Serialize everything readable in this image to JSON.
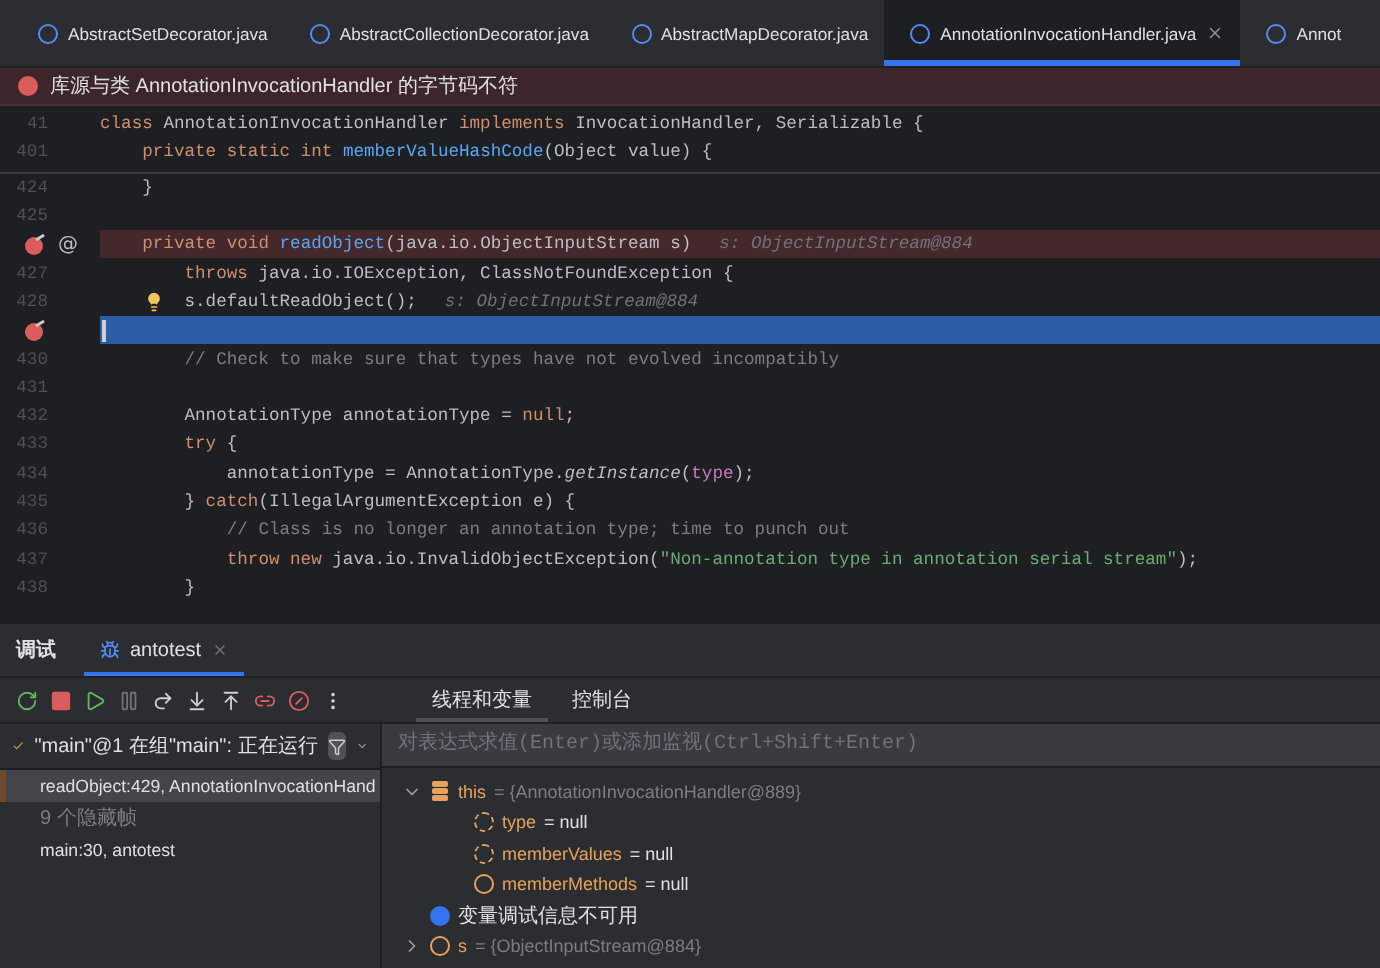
{
  "editor_tabs": [
    {
      "label": "AbstractSetDecorator.java",
      "selected": false,
      "closable": false
    },
    {
      "label": "AbstractCollectionDecorator.java",
      "selected": false,
      "closable": false
    },
    {
      "label": "AbstractMapDecorator.java",
      "selected": false,
      "closable": false
    },
    {
      "label": "AnnotationInvocationHandler.java",
      "selected": true,
      "closable": true
    },
    {
      "label": "Annot",
      "selected": false,
      "closable": false
    }
  ],
  "banner": {
    "message": "库源与类 AnnotationInvocationHandler 的字节码不符"
  },
  "sticky_lines": [
    {
      "number": "41",
      "tokens": [
        {
          "text": "class ",
          "kind": "kw"
        },
        {
          "text": "AnnotationInvocationHandler ",
          "kind": "plain"
        },
        {
          "text": "implements ",
          "kind": "kw"
        },
        {
          "text": "InvocationHandler, Serializable {",
          "kind": "plain"
        }
      ]
    },
    {
      "number": "401",
      "tokens": [
        {
          "text": "    private static int ",
          "kind": "kw"
        },
        {
          "text": "memberValueHashCode",
          "kind": "fn"
        },
        {
          "text": "(Object value) {",
          "kind": "plain"
        }
      ]
    }
  ],
  "code_lines": [
    {
      "number": "424",
      "breakpoint": false,
      "current": false,
      "bulb": false,
      "tokens": [
        {
          "text": "    }",
          "kind": "plain"
        }
      ]
    },
    {
      "number": "425",
      "breakpoint": false,
      "current": false,
      "bulb": false
    },
    {
      "breakpoint": true,
      "override_mark": "@",
      "current": false,
      "bulb": false,
      "tokens": [
        {
          "text": "    private void ",
          "kind": "kw"
        },
        {
          "text": "readObject",
          "kind": "fn"
        },
        {
          "text": "(java.io.ObjectInputStream s)",
          "kind": "plain"
        }
      ],
      "hint": "s: ObjectInputStream@884"
    },
    {
      "number": "427",
      "breakpoint": false,
      "current": false,
      "bulb": false,
      "tokens": [
        {
          "text": "        throws ",
          "kind": "kw"
        },
        {
          "text": "java.io.IOException, ClassNotFoundException {",
          "kind": "plain"
        }
      ]
    },
    {
      "number": "428",
      "breakpoint": false,
      "current": false,
      "bulb": true,
      "tokens": [
        {
          "text": "        s.defaultReadObject();",
          "kind": "plain"
        }
      ],
      "hint": "s: ObjectInputStream@884"
    },
    {
      "breakpoint": true,
      "current": true,
      "bulb": false
    },
    {
      "number": "430",
      "breakpoint": false,
      "current": false,
      "bulb": false,
      "tokens": [
        {
          "text": "        // Check to make sure that types have not evolved incompatibly",
          "kind": "comment"
        }
      ]
    },
    {
      "number": "431",
      "breakpoint": false,
      "current": false,
      "bulb": false
    },
    {
      "number": "432",
      "breakpoint": false,
      "current": false,
      "bulb": false,
      "tokens": [
        {
          "text": "        AnnotationType annotationType = ",
          "kind": "plain"
        },
        {
          "text": "null",
          "kind": "kw"
        },
        {
          "text": ";",
          "kind": "plain"
        }
      ]
    },
    {
      "number": "433",
      "breakpoint": false,
      "current": false,
      "bulb": false,
      "tokens": [
        {
          "text": "        try ",
          "kind": "kw"
        },
        {
          "text": "{",
          "kind": "plain"
        }
      ]
    },
    {
      "number": "434",
      "breakpoint": false,
      "current": false,
      "bulb": false,
      "tokens": [
        {
          "text": "            annotationType = AnnotationType.",
          "kind": "plain"
        },
        {
          "text": "getInstance",
          "kind": "static"
        },
        {
          "text": "(",
          "kind": "plain"
        },
        {
          "text": "type",
          "kind": "field"
        },
        {
          "text": ");",
          "kind": "plain"
        }
      ]
    },
    {
      "number": "435",
      "breakpoint": false,
      "current": false,
      "bulb": false,
      "tokens": [
        {
          "text": "        } ",
          "kind": "plain"
        },
        {
          "text": "catch",
          "kind": "kw"
        },
        {
          "text": "(IllegalArgumentException e) {",
          "kind": "plain"
        }
      ]
    },
    {
      "number": "436",
      "breakpoint": false,
      "current": false,
      "bulb": false,
      "tokens": [
        {
          "text": "            // Class is no longer an annotation type; time to punch out",
          "kind": "comment"
        }
      ]
    },
    {
      "number": "437",
      "breakpoint": false,
      "current": false,
      "bulb": false,
      "tokens": [
        {
          "text": "            throw new ",
          "kind": "kw"
        },
        {
          "text": "java.io.InvalidObjectException(",
          "kind": "plain"
        },
        {
          "text": "\"Non-annotation type in annotation serial stream\"",
          "kind": "str"
        },
        {
          "text": ");",
          "kind": "plain"
        }
      ]
    },
    {
      "number": "438",
      "breakpoint": false,
      "current": false,
      "bulb": false,
      "tokens": [
        {
          "text": "        }",
          "kind": "plain"
        }
      ]
    }
  ],
  "debug": {
    "title": "调试",
    "session_tabs": [
      {
        "label": "antotest",
        "selected": true
      }
    ],
    "view_tabs": [
      {
        "label": "线程和变量",
        "selected": true
      },
      {
        "label": "控制台",
        "selected": false
      }
    ],
    "thread": {
      "label": "\"main\"@1 在组\"main\": 正在运行"
    },
    "frames": [
      {
        "label": "readObject:429, AnnotationInvocationHand",
        "kind": "frame",
        "selected": true
      },
      {
        "label": "9 个隐藏帧",
        "kind": "hidden",
        "selected": false
      },
      {
        "label": "main:30, antotest",
        "kind": "frame",
        "selected": false
      }
    ],
    "eval_placeholder": "对表达式求值(Enter)或添加监视(Ctrl+Shift+Enter)",
    "variables": [
      {
        "kind": "object",
        "name": "this",
        "value": "= {AnnotationInvocationHandler@889}",
        "expanded": true,
        "children": [
          {
            "kind": "transient_field",
            "name": "type",
            "value": "= null"
          },
          {
            "kind": "transient_field",
            "name": "memberValues",
            "value": "= null"
          },
          {
            "kind": "field",
            "name": "memberMethods",
            "value": "= null"
          }
        ]
      },
      {
        "kind": "info",
        "name": "变量调试信息不可用"
      },
      {
        "kind": "param",
        "name": "s",
        "value": "= {ObjectInputStream@884}",
        "expanded": false
      }
    ]
  }
}
